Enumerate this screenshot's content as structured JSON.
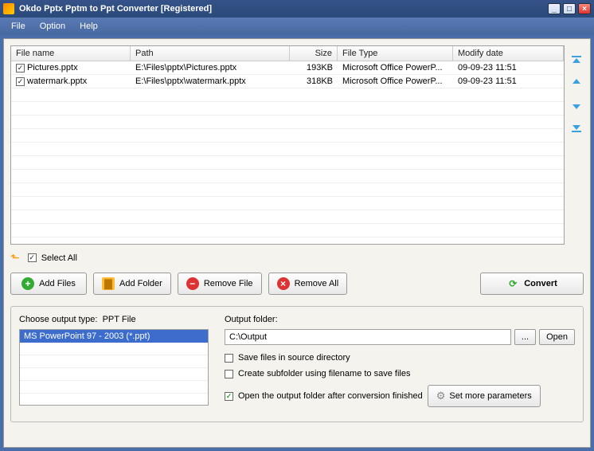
{
  "window": {
    "title": "Okdo Pptx Pptm to Ppt Converter [Registered]"
  },
  "menu": {
    "file": "File",
    "option": "Option",
    "help": "Help"
  },
  "table": {
    "headers": {
      "filename": "File name",
      "path": "Path",
      "size": "Size",
      "filetype": "File Type",
      "modify": "Modify date"
    },
    "rows": [
      {
        "checked": true,
        "filename": "Pictures.pptx",
        "path": "E:\\Files\\pptx\\Pictures.pptx",
        "size": "193KB",
        "filetype": "Microsoft Office PowerP...",
        "modify": "09-09-23 11:51"
      },
      {
        "checked": true,
        "filename": "watermark.pptx",
        "path": "E:\\Files\\pptx\\watermark.pptx",
        "size": "318KB",
        "filetype": "Microsoft Office PowerP...",
        "modify": "09-09-23 11:51"
      }
    ]
  },
  "selectall": {
    "label": "Select All",
    "checked": true
  },
  "buttons": {
    "addfiles": "Add Files",
    "addfolder": "Add Folder",
    "removefile": "Remove File",
    "removeall": "Remove All",
    "convert": "Convert"
  },
  "output": {
    "typelabel": "Choose output type:",
    "typevalue": "PPT File",
    "listitem": "MS PowerPoint 97 - 2003 (*.ppt)",
    "folderlabel": "Output folder:",
    "foldervalue": "C:\\Output",
    "browse": "...",
    "open": "Open",
    "save_source": {
      "checked": false,
      "label": "Save files in source directory"
    },
    "create_sub": {
      "checked": false,
      "label": "Create subfolder using filename to save files"
    },
    "open_after": {
      "checked": true,
      "label": "Open the output folder after conversion finished"
    },
    "setmore": "Set more parameters"
  }
}
